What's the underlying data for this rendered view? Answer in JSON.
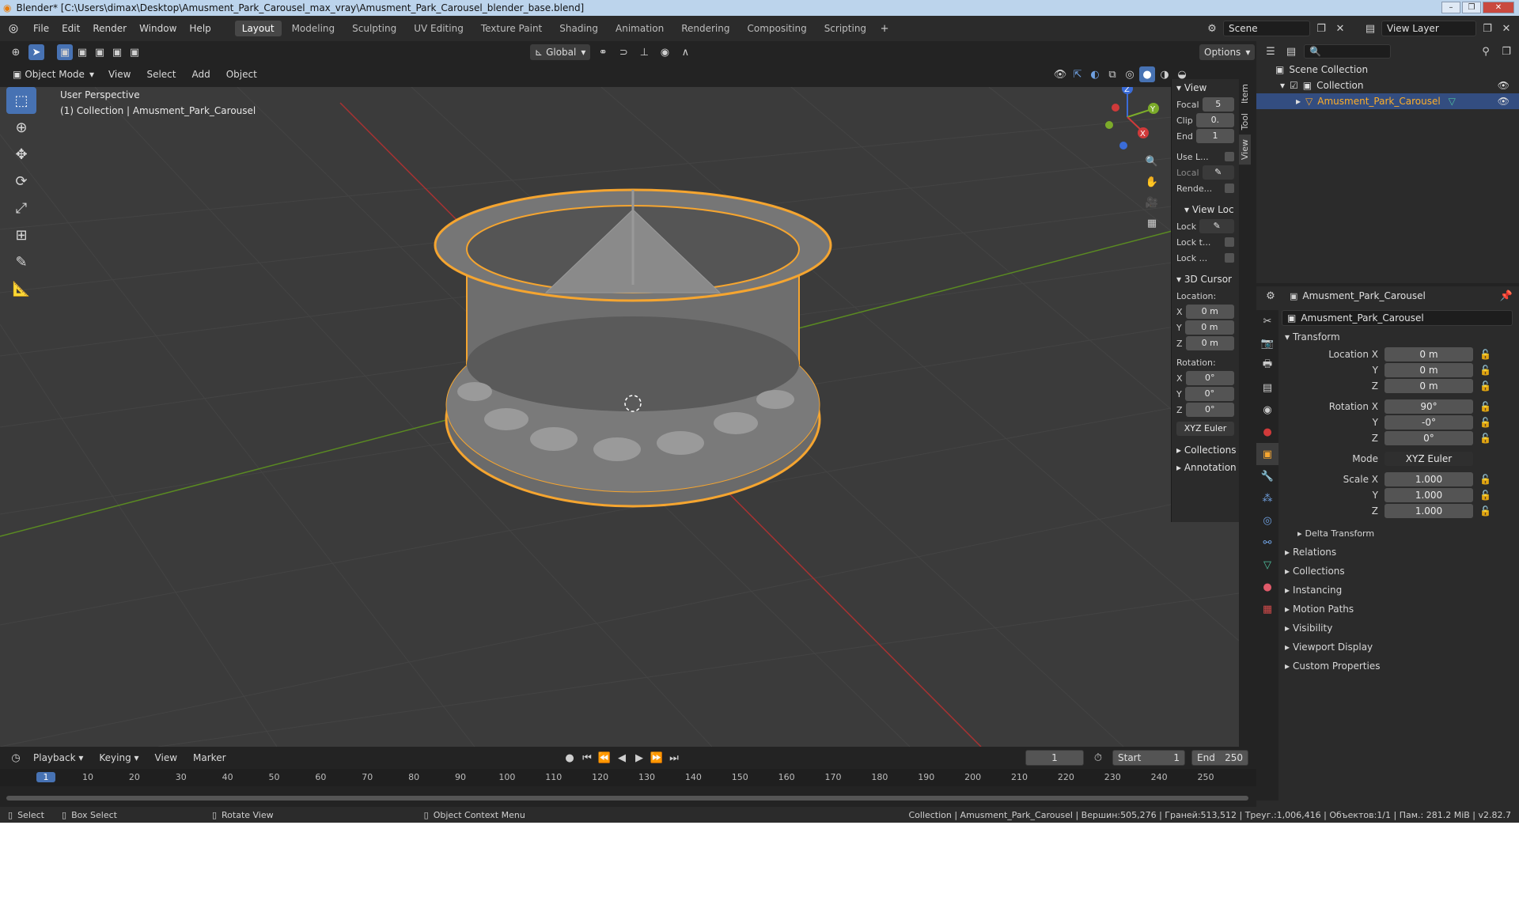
{
  "window": {
    "title": "Blender* [C:\\Users\\dimax\\Desktop\\Amusment_Park_Carousel_max_vray\\Amusment_Park_Carousel_blender_base.blend]"
  },
  "menu": [
    "File",
    "Edit",
    "Render",
    "Window",
    "Help"
  ],
  "workspaces": [
    "Layout",
    "Modeling",
    "Sculpting",
    "UV Editing",
    "Texture Paint",
    "Shading",
    "Animation",
    "Rendering",
    "Compositing",
    "Scripting"
  ],
  "active_workspace": "Layout",
  "scene": {
    "name": "Scene",
    "view_layer": "View Layer"
  },
  "viewport_header": {
    "orientation": "Global",
    "options": "Options",
    "mode": "Object Mode",
    "menus": [
      "View",
      "Select",
      "Add",
      "Object"
    ]
  },
  "viewport": {
    "perspective": "User Perspective",
    "collection_info": "(1) Collection | Amusment_Park_Carousel",
    "gizmo_axes": [
      "Z",
      "Y",
      "X"
    ]
  },
  "tools": [
    "select-box",
    "cursor",
    "move",
    "rotate",
    "scale",
    "transform",
    "annotate",
    "measure"
  ],
  "npanel": {
    "tabs": [
      "Item",
      "Tool",
      "View"
    ],
    "active_tab": "View",
    "view_title": "View",
    "focal_label": "Focal",
    "focal_value": "5",
    "clip_label": "Clip",
    "clip_value": "0.",
    "end_label": "End",
    "end_value": "1",
    "use_local": "Use L...",
    "local": "Local",
    "render": "Rende...",
    "view_lock_title": "View Loc",
    "lock": "Lock",
    "lock_to": "Lock t...",
    "lock_more": "Lock ...",
    "cursor_title": "3D Cursor",
    "location_label": "Location:",
    "loc_x": "0 m",
    "loc_y": "0 m",
    "loc_z": "0 m",
    "rotation_label": "Rotation:",
    "rot_x": "0°",
    "rot_y": "0°",
    "rot_z": "0°",
    "rot_mode": "XYZ Euler",
    "collections": "Collections",
    "annotations": "Annotation",
    "axis_x": "X",
    "axis_y": "Y",
    "axis_z": "Z"
  },
  "outliner": {
    "scene_collection": "Scene Collection",
    "collection": "Collection",
    "object": "Amusment_Park_Carousel"
  },
  "properties": {
    "object_name": "Amusment_Park_Carousel",
    "object_field": "Amusment_Park_Carousel",
    "transform_title": "Transform",
    "location_x_label": "Location X",
    "location_x": "0 m",
    "y_label": "Y",
    "z_label": "Z",
    "location_y": "0 m",
    "location_z": "0 m",
    "rotation_x_label": "Rotation X",
    "rotation_x": "90°",
    "rotation_y": "-0°",
    "rotation_z": "0°",
    "mode_label": "Mode",
    "mode_value": "XYZ Euler",
    "scale_x_label": "Scale X",
    "scale_x": "1.000",
    "scale_y": "1.000",
    "scale_z": "1.000",
    "delta_transform": "Delta Transform",
    "sections": [
      "Relations",
      "Collections",
      "Instancing",
      "Motion Paths",
      "Visibility",
      "Viewport Display",
      "Custom Properties"
    ]
  },
  "timeline": {
    "menus": [
      "Playback",
      "Keying",
      "View",
      "Marker"
    ],
    "current_frame": "1",
    "start_label": "Start",
    "start": "1",
    "end_label": "End",
    "end": "250",
    "ticks": [
      "1",
      "10",
      "20",
      "30",
      "40",
      "50",
      "60",
      "70",
      "80",
      "90",
      "100",
      "110",
      "120",
      "130",
      "140",
      "150",
      "160",
      "170",
      "180",
      "190",
      "200",
      "210",
      "220",
      "230",
      "240",
      "250"
    ]
  },
  "statusbar": {
    "select": "Select",
    "box_select": "Box Select",
    "rotate_view": "Rotate View",
    "context_menu": "Object Context Menu",
    "stats": "Collection | Amusment_Park_Carousel | Вершин:505,276 | Граней:513,512 | Треуг.:1,006,416 | Объектов:1/1 | Пам.: 281.2 MiB | v2.82.7"
  },
  "colors": {
    "accent": "#4772b3",
    "selection": "#f5a530",
    "grid_x": "#a83232",
    "grid_y": "#5a8a22",
    "viewport_bg": "#3b3b3b"
  }
}
